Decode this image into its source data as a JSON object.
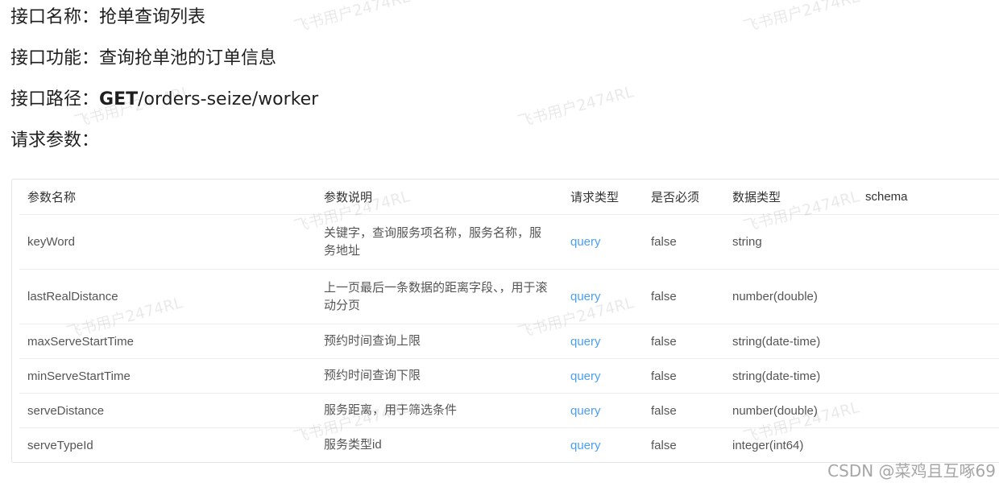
{
  "api": {
    "name_label": "接口名称：",
    "name_value": "抢单查询列表",
    "function_label": "接口功能：",
    "function_value": "查询抢单池的订单信息",
    "path_label": "接口路径：",
    "path_method": "GET",
    "path_value": "/orders-seize/worker",
    "params_label": "请求参数："
  },
  "params_table": {
    "headers": [
      "参数名称",
      "参数说明",
      "请求类型",
      "是否必须",
      "数据类型",
      "schema"
    ],
    "rows": [
      {
        "name": "keyWord",
        "desc": "关键字，查询服务项名称，服务名称，服务地址",
        "in": "query",
        "required": "false",
        "type": "string",
        "schema": ""
      },
      {
        "name": "lastRealDistance",
        "desc": "上一页最后一条数据的距离字段、，用于滚动分页",
        "in": "query",
        "required": "false",
        "type": "number(double)",
        "schema": ""
      },
      {
        "name": "maxServeStartTime",
        "desc": "预约时间查询上限",
        "in": "query",
        "required": "false",
        "type": "string(date-time)",
        "schema": ""
      },
      {
        "name": "minServeStartTime",
        "desc": "预约时间查询下限",
        "in": "query",
        "required": "false",
        "type": "string(date-time)",
        "schema": ""
      },
      {
        "name": "serveDistance",
        "desc": "服务距离，用于筛选条件",
        "in": "query",
        "required": "false",
        "type": "number(double)",
        "schema": ""
      },
      {
        "name": "serveTypeId",
        "desc": "服务类型id",
        "in": "query",
        "required": "false",
        "type": "integer(int64)",
        "schema": ""
      }
    ]
  },
  "watermark_text": "飞书用户2474RL",
  "footer_brand": "CSDN @菜鸡且互啄69",
  "colors": {
    "query": "#4a9ff5",
    "text": "#1f1f1f",
    "table_text": "#555555",
    "border": "#e5e5e5"
  }
}
